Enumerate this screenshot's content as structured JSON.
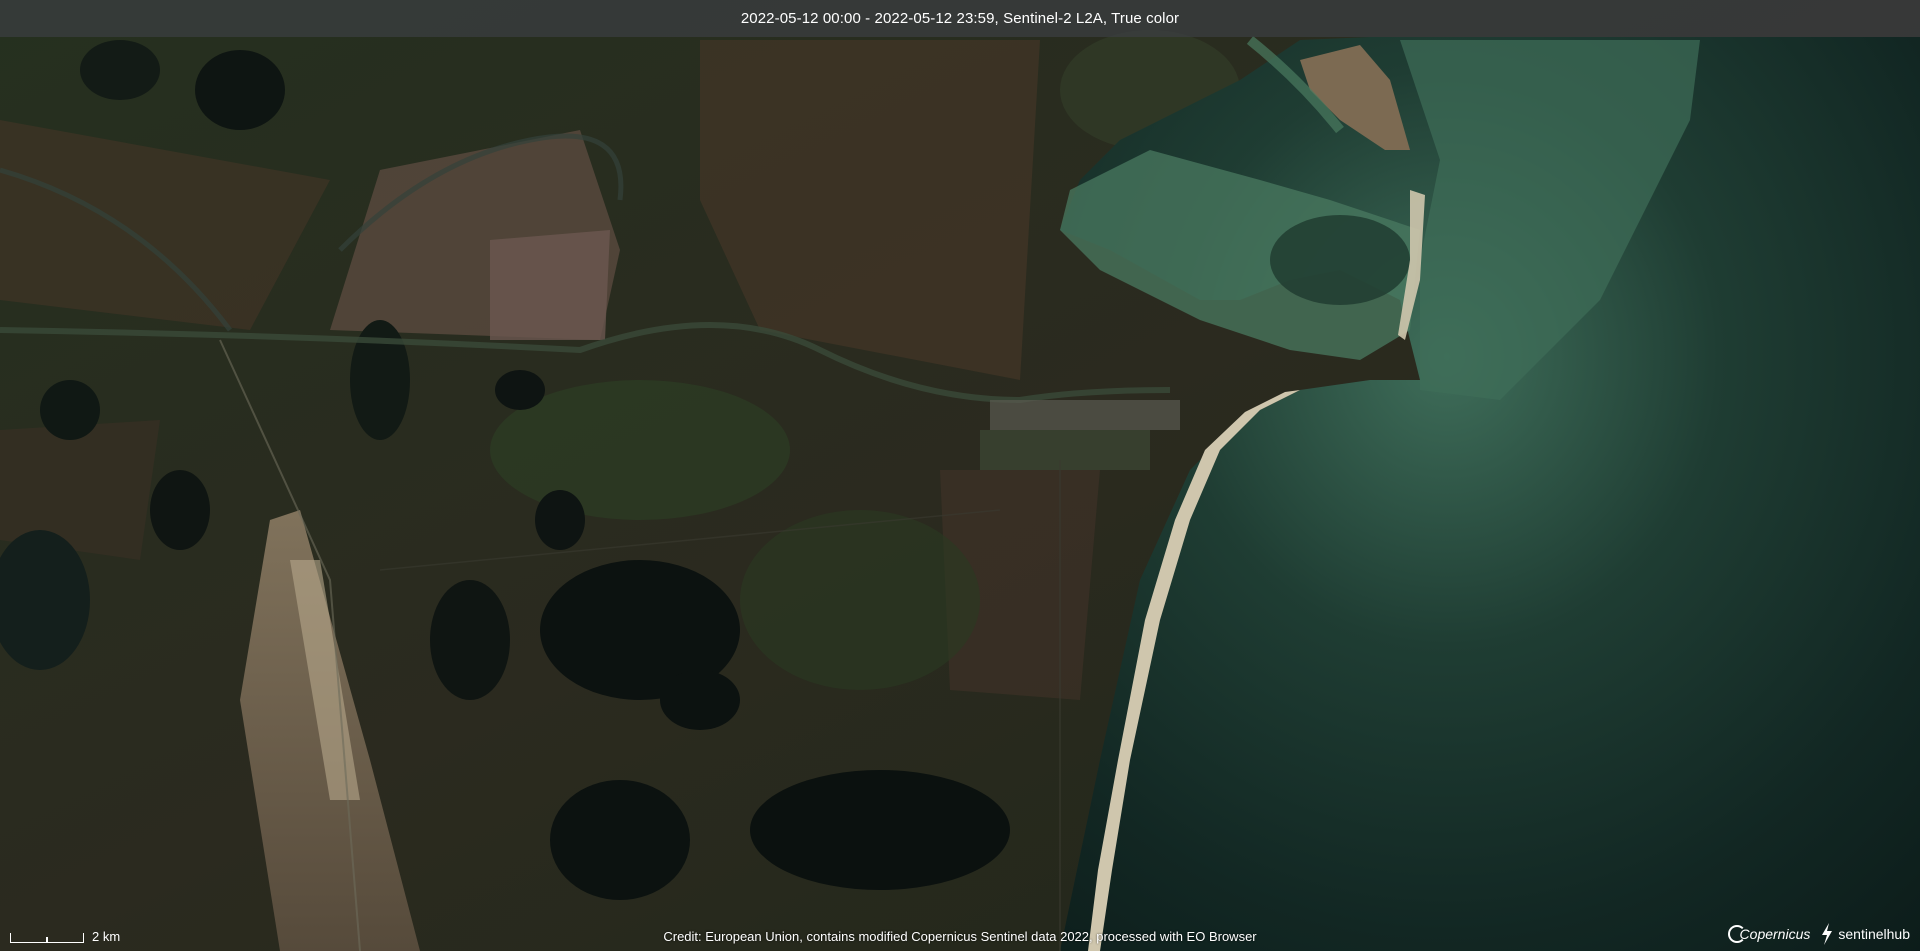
{
  "header": {
    "title": "2022-05-12 00:00 - 2022-05-12 23:59, Sentinel-2 L2A, True color"
  },
  "scale": {
    "label": "2 km"
  },
  "footer": {
    "credit": "Credit: European Union, contains modified Copernicus Sentinel data 2022, processed with EO Browser"
  },
  "logos": {
    "copernicus": "Copernicus",
    "sentinelhub": "sentinelhub"
  },
  "colors": {
    "land_dark": "#1f2a1b",
    "land_brown": "#4a3a2a",
    "sea_shallow": "#3e6a55",
    "sea_deep": "#0e201d",
    "beach": "#cfc6ad"
  }
}
